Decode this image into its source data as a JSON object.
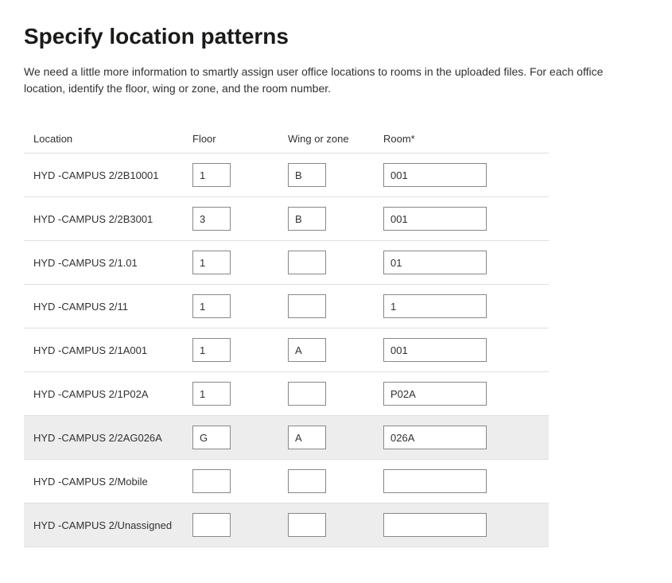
{
  "title": "Specify location patterns",
  "description": "We need a little more information to smartly assign user office locations to rooms in the uploaded files. For each office location, identify the floor, wing or zone, and the room number.",
  "columns": {
    "location": "Location",
    "floor": "Floor",
    "wing": "Wing or zone",
    "room": "Room*"
  },
  "rows": [
    {
      "location": "HYD -CAMPUS 2/2B10001",
      "floor": "1",
      "wing": "B",
      "room": "001"
    },
    {
      "location": "HYD -CAMPUS 2/2B3001",
      "floor": "3",
      "wing": "B",
      "room": "001"
    },
    {
      "location": "HYD -CAMPUS 2/1.01",
      "floor": "1",
      "wing": "",
      "room": "01"
    },
    {
      "location": "HYD -CAMPUS 2/11",
      "floor": "1",
      "wing": "",
      "room": "1"
    },
    {
      "location": "HYD -CAMPUS 2/1A001",
      "floor": "1",
      "wing": "A",
      "room": "001"
    },
    {
      "location": "HYD -CAMPUS 2/1P02A",
      "floor": "1",
      "wing": "",
      "room": "P02A"
    },
    {
      "location": "HYD -CAMPUS 2/2AG026A",
      "floor": "G",
      "wing": "A",
      "room": "026A"
    },
    {
      "location": "HYD -CAMPUS 2/Mobile",
      "floor": "",
      "wing": "",
      "room": ""
    },
    {
      "location": "HYD -CAMPUS 2/Unassigned",
      "floor": "",
      "wing": "",
      "room": ""
    }
  ]
}
